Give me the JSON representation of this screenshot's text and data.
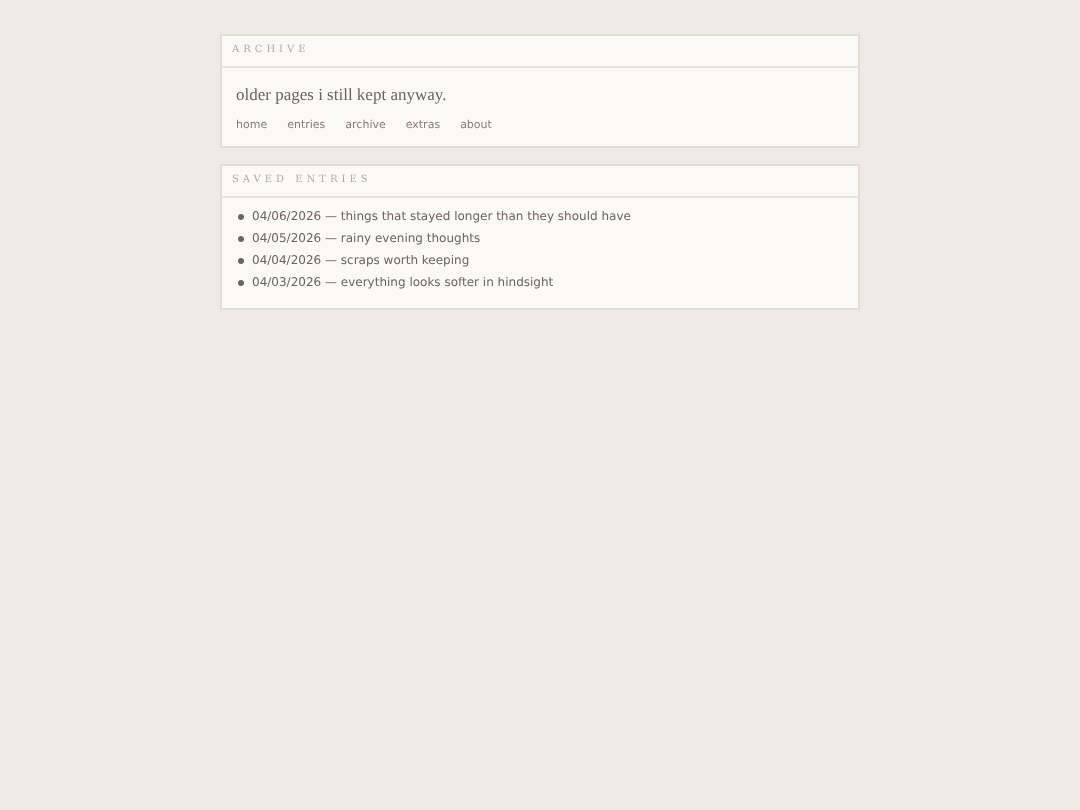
{
  "archive_panel": {
    "heading": "ARCHIVE",
    "tagline": "older pages i still kept anyway.",
    "nav_links": [
      "home",
      "entries",
      "archive",
      "extras",
      "about"
    ]
  },
  "saved_entries_panel": {
    "heading": "SAVED ENTRIES",
    "entries": [
      "04/06/2026 — things that stayed longer than they should have",
      "04/05/2026 — rainy evening thoughts",
      "04/04/2026 — scraps worth keeping",
      "04/03/2026 — everything looks softer in hindsight"
    ]
  }
}
